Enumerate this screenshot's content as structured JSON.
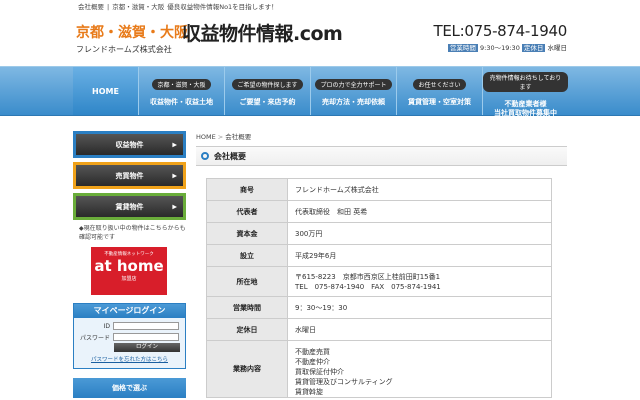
{
  "topbar": {
    "items": [
      "会社概要",
      "|",
      "京都・滋賀・大阪",
      "優良収益物件情報No1を目指します！"
    ]
  },
  "header": {
    "region": "京都・滋賀・大阪",
    "site_name": "収益物件情報.com",
    "company": "フレンドホームズ株式会社",
    "tel": "TEL:075-874-1940",
    "hours_label": "営業時間",
    "hours": "9:30〜19:30",
    "closed_label": "定休日",
    "closed": "水曜日"
  },
  "nav": {
    "home": "HOME",
    "items": [
      {
        "tag": "京都・滋賀・大阪",
        "label": "収益物件・収益土地"
      },
      {
        "tag": "ご希望の物件探します",
        "label": "ご要望・来店予約"
      },
      {
        "tag": "プロの力で全力サポート",
        "label": "売却方法・売却依頼"
      },
      {
        "tag": "お任せください",
        "label": "賃貸管理・空室対策"
      },
      {
        "tag": "売物件情報お待ちしております",
        "label": "不動産業者様\n当社買取物件募集中"
      }
    ]
  },
  "sidebar": {
    "buttons": [
      "収益物件",
      "売買物件",
      "賃貸物件"
    ],
    "note": "◆現在取り扱い中の物件はこちらからも確認可能です",
    "athome": {
      "small": "不動産情報ネットワーク",
      "big": "at home",
      "sub": "加盟店"
    },
    "mypage": {
      "title": "マイページログイン",
      "id_label": "ID",
      "password_label": "パスワード",
      "login_button": "ログイン",
      "forgot_link": "パスワードを忘れた方はこちら"
    },
    "price_box": "価格で選ぶ"
  },
  "content": {
    "breadcrumb": [
      "HOME",
      "会社概要"
    ],
    "heading": "会社概要",
    "table": [
      {
        "label": "商号",
        "value": "フレンドホームズ株式会社"
      },
      {
        "label": "代表者",
        "value": "代表取締役　和田 英希"
      },
      {
        "label": "資本金",
        "value": "300万円"
      },
      {
        "label": "設立",
        "value": "平成29年6月"
      },
      {
        "label": "所在地",
        "value": "〒615-8223　京都市西京区上桂前田町15番1",
        "value2": "TEL　075-874-1940　FAX　075-874-1941"
      },
      {
        "label": "営業時間",
        "value": "9：30〜19：30"
      },
      {
        "label": "定休日",
        "value": "水曜日"
      },
      {
        "label": "業務内容",
        "lines": [
          "不動産売買",
          "不動産仲介",
          "買取保証付仲介",
          "賃貸管理及びコンサルティング",
          "賃貸斡旋"
        ]
      }
    ]
  },
  "colors": {
    "accent": "#2b7fc3",
    "orange": "#f0a21a",
    "green": "#6aad3a",
    "athome_red": "#d81e2a",
    "region_orange": "#e87b1a"
  }
}
